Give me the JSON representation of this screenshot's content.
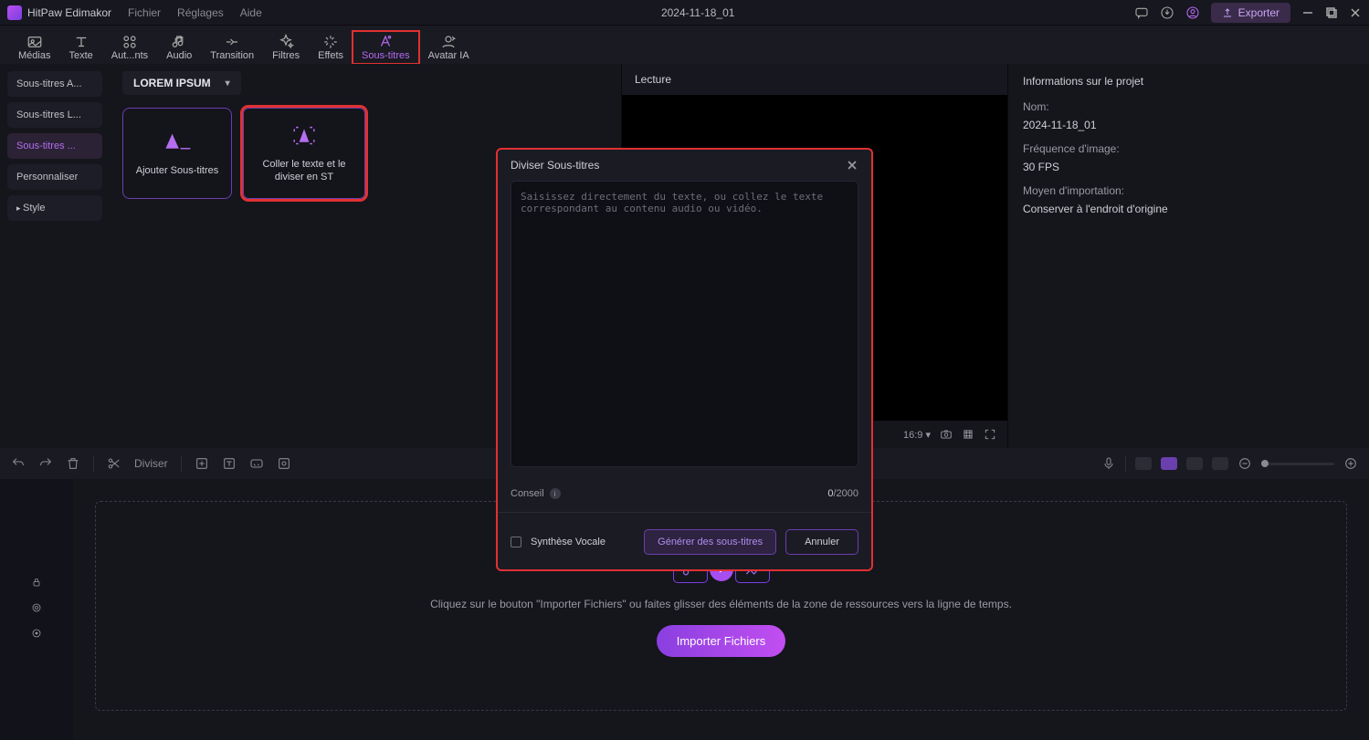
{
  "app": {
    "name": "HitPaw Edimakor"
  },
  "menubar": {
    "items": [
      "Fichier",
      "Réglages",
      "Aide"
    ]
  },
  "project_title": "2024-11-18_01",
  "titlebar": {
    "export": "Exporter"
  },
  "tooltabs": [
    {
      "label": "Médias"
    },
    {
      "label": "Texte"
    },
    {
      "label": "Aut...nts"
    },
    {
      "label": "Audio"
    },
    {
      "label": "Transition"
    },
    {
      "label": "Filtres"
    },
    {
      "label": "Effets"
    },
    {
      "label": "Sous-titres",
      "active": true,
      "highlight": true
    },
    {
      "label": "Avatar IA"
    }
  ],
  "subtabs": {
    "items": [
      "Sous-titres A...",
      "Sous-titres L...",
      "Sous-titres ...",
      "Personnaliser",
      "Style"
    ],
    "active_index": 2
  },
  "lorem_chip": "LOREM IPSUM",
  "cards": {
    "add": "Ajouter Sous-titres",
    "paste": "Coller le texte et le diviser en ST"
  },
  "preview": {
    "title": "Lecture",
    "ratio": "16:9 ▾"
  },
  "project_info": {
    "title": "Informations sur le projet",
    "name_label": "Nom:",
    "name_value": "2024-11-18_01",
    "fps_label": "Fréquence d'image:",
    "fps_value": "30 FPS",
    "import_label": "Moyen d'importation:",
    "import_value": "Conserver à l'endroit d'origine"
  },
  "tl_toolbar": {
    "split": "Diviser"
  },
  "dropzone": {
    "hint": "Cliquez sur le bouton \"Importer Fichiers\" ou faites glisser des éléments de la zone de ressources vers la ligne de temps.",
    "button": "Importer Fichiers"
  },
  "modal": {
    "title": "Diviser Sous-titres",
    "placeholder": "Saisissez directement du texte, ou collez le texte correspondant au contenu audio ou vidéo.",
    "counsel": "Conseil",
    "count_current": "0",
    "count_max": "/2000",
    "tts_label": "Synthèse Vocale",
    "generate": "Générer des sous-titres",
    "cancel": "Annuler"
  }
}
